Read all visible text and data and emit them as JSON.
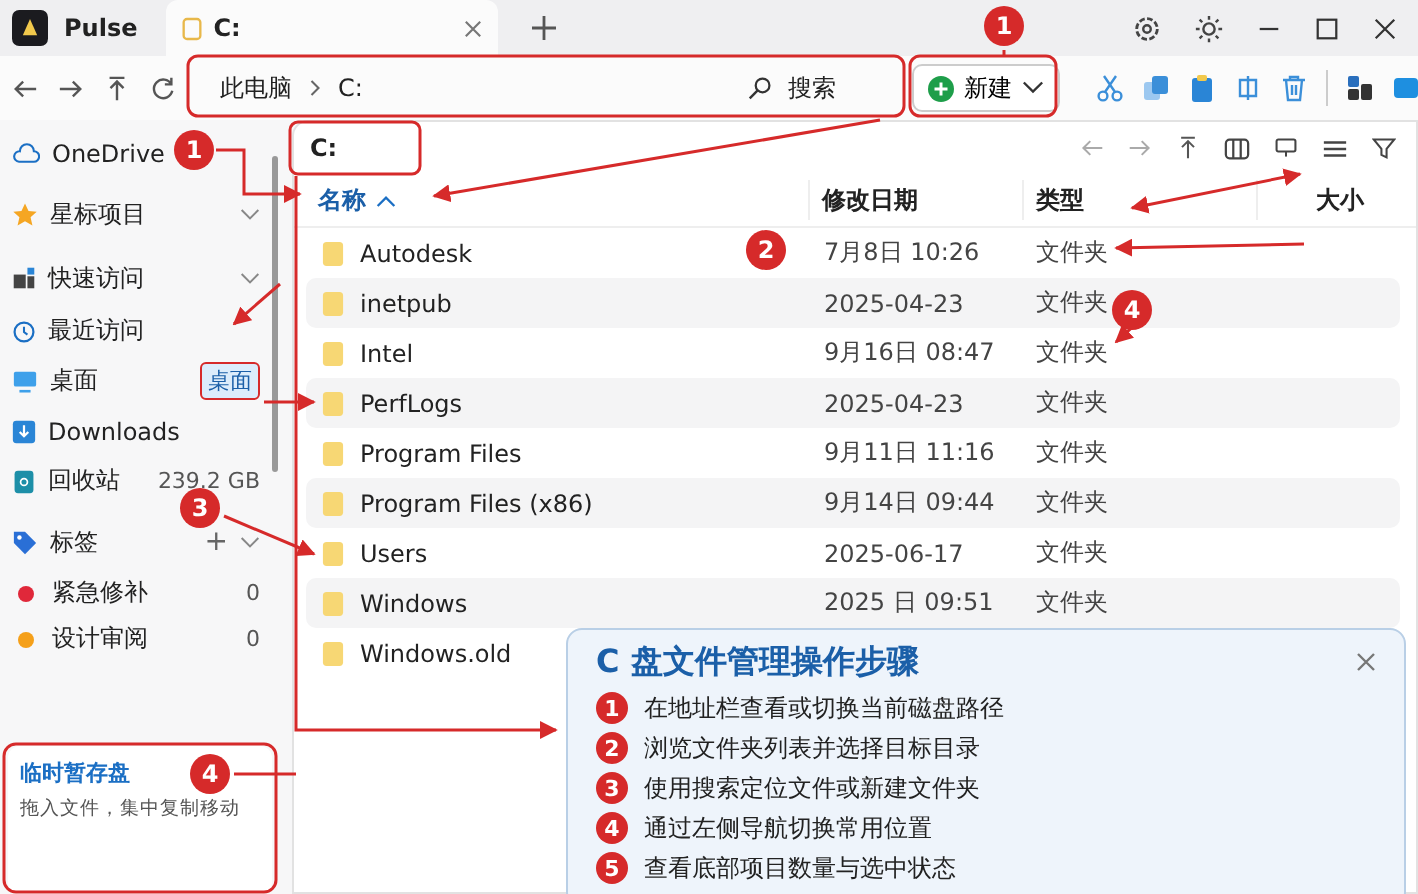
{
  "app": {
    "name": "Pulse"
  },
  "tabs": [
    {
      "label": "C:",
      "selected": true
    }
  ],
  "toolbar": {
    "breadcrumb": [
      "此电脑",
      "C:"
    ],
    "search": {
      "placeholder": "搜索"
    },
    "new_button": "新建"
  },
  "sidebar": {
    "items": [
      {
        "kind": "link",
        "label": "OneDrive"
      },
      {
        "kind": "section",
        "label": "星标项目"
      },
      {
        "kind": "section",
        "label": "快速访问"
      },
      {
        "kind": "link",
        "label": "最近访问"
      },
      {
        "kind": "link",
        "label": "桌面",
        "badge": "桌面"
      },
      {
        "kind": "link",
        "label": "Downloads"
      },
      {
        "kind": "link",
        "label": "回收站",
        "detail": "239.2 GB"
      },
      {
        "kind": "section",
        "label": "标签",
        "action": "+"
      },
      {
        "kind": "tag",
        "label": "紧急修补",
        "color": "#e0283a",
        "count": "0"
      },
      {
        "kind": "tag",
        "label": "设计审阅",
        "color": "#f5a01a",
        "count": "0"
      }
    ],
    "tray": {
      "title": "临时暂存盘",
      "hint": "拖入文件，集中复制移动"
    }
  },
  "main": {
    "path": "C:",
    "columns": [
      {
        "label": "名称",
        "sorted": true
      },
      {
        "label": "修改日期",
        "sorted": false
      },
      {
        "label": "类型",
        "sorted": false
      },
      {
        "label": "大小",
        "sorted": false
      }
    ],
    "rows": [
      {
        "name": "Autodesk",
        "date": "7月8日 10:26",
        "type": "文件夹"
      },
      {
        "name": "inetpub",
        "date": "2025-04-23",
        "type": "文件夹"
      },
      {
        "name": "Intel",
        "date": "9月16日 08:47",
        "type": "文件夹"
      },
      {
        "name": "PerfLogs",
        "date": "2025-04-23",
        "type": "文件夹"
      },
      {
        "name": "Program Files",
        "date": "9月11日 11:16",
        "type": "文件夹"
      },
      {
        "name": "Program Files (x86)",
        "date": "9月14日 09:44",
        "type": "文件夹"
      },
      {
        "name": "Users",
        "date": "2025-06-17",
        "type": "文件夹"
      },
      {
        "name": "Windows",
        "date": "2025 日 09:51",
        "type": "文件夹"
      },
      {
        "name": "Windows.old"
      }
    ]
  },
  "guide": {
    "title": "C 盘文件管理操作步骤",
    "steps": [
      {
        "number": "1",
        "text": "在地址栏查看或切换当前磁盘路径"
      },
      {
        "number": "2",
        "text": "浏览文件夹列表并选择目标目录"
      },
      {
        "number": "3",
        "text": "使用搜索定位文件或新建文件夹"
      },
      {
        "number": "4",
        "text": "通过左侧导航切换常用位置"
      },
      {
        "number": "5",
        "text": "查看底部项目数量与选中状态"
      }
    ]
  },
  "callouts": [
    {
      "number": "1"
    },
    {
      "number": "1"
    },
    {
      "number": "2"
    },
    {
      "number": "3"
    },
    {
      "number": "4"
    },
    {
      "number": "4"
    }
  ]
}
